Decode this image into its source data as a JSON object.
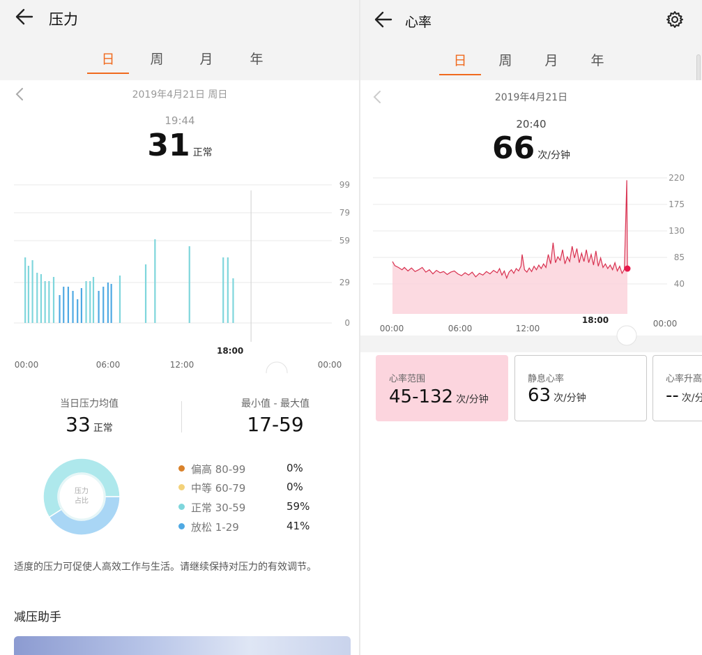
{
  "stress": {
    "title": "压力",
    "tabs": [
      "日",
      "周",
      "月",
      "年"
    ],
    "active_tab": 0,
    "date": "2019年4月21日 周日",
    "time": "19:44",
    "value": "31",
    "value_label": "正常",
    "chart_data": {
      "type": "bar",
      "y_ticks": [
        "99",
        "79",
        "59",
        "29",
        "0"
      ],
      "y_tick_values": [
        99,
        79,
        59,
        29,
        0
      ],
      "x_ticks": [
        "00:00",
        "06:00",
        "12:00",
        "18:00",
        "00:00"
      ],
      "ylim": [
        0,
        99
      ],
      "xlim_hours": [
        0,
        24
      ],
      "bars": [
        {
          "hour": 0.85,
          "value": 47
        },
        {
          "hour": 1.1,
          "value": 41
        },
        {
          "hour": 1.4,
          "value": 45
        },
        {
          "hour": 1.75,
          "value": 36
        },
        {
          "hour": 2.05,
          "value": 35
        },
        {
          "hour": 2.35,
          "value": 30
        },
        {
          "hour": 2.65,
          "value": 30
        },
        {
          "hour": 3.0,
          "value": 33
        },
        {
          "hour": 3.45,
          "value": 20
        },
        {
          "hour": 3.75,
          "value": 26
        },
        {
          "hour": 4.1,
          "value": 26
        },
        {
          "hour": 4.45,
          "value": 23
        },
        {
          "hour": 4.8,
          "value": 17
        },
        {
          "hour": 5.1,
          "value": 25
        },
        {
          "hour": 5.45,
          "value": 30
        },
        {
          "hour": 5.75,
          "value": 30
        },
        {
          "hour": 6.0,
          "value": 33
        },
        {
          "hour": 6.4,
          "value": 23
        },
        {
          "hour": 6.75,
          "value": 26
        },
        {
          "hour": 7.1,
          "value": 29
        },
        {
          "hour": 7.35,
          "value": 28
        },
        {
          "hour": 8.0,
          "value": 34
        },
        {
          "hour": 9.95,
          "value": 42
        },
        {
          "hour": 10.65,
          "value": 60
        },
        {
          "hour": 13.25,
          "value": 55
        },
        {
          "hour": 15.8,
          "value": 47
        },
        {
          "hour": 16.15,
          "value": 47
        },
        {
          "hour": 16.55,
          "value": 32
        }
      ],
      "cursor_label": "18:00"
    },
    "avg_label": "当日压力均值",
    "avg_value": "33",
    "avg_value_label": "正常",
    "range_label": "最小值 - 最大值",
    "range_value": "17-59",
    "donut_label_1": "压力",
    "donut_label_2": "占比",
    "legend": [
      {
        "label": "偏高 80-99",
        "pct": "0%",
        "color": "#d9822b",
        "value": 0
      },
      {
        "label": "中等 60-79",
        "pct": "0%",
        "color": "#f3d27a",
        "value": 0
      },
      {
        "label": "正常 30-59",
        "pct": "59%",
        "color": "#7fd6dc",
        "value": 59
      },
      {
        "label": "放松 1-29",
        "pct": "41%",
        "color": "#4fa9e3",
        "value": 41
      }
    ],
    "advice": "适度的压力可促使人高效工作与生活。请继续保持对压力的有效调节。",
    "section_title": "减压助手"
  },
  "heart": {
    "title": "心率",
    "tabs": [
      "日",
      "周",
      "月",
      "年"
    ],
    "active_tab": 0,
    "date": "2019年4月21日",
    "time": "20:40",
    "value": "66",
    "unit": "次/分钟",
    "chart_data": {
      "type": "area",
      "y_ticks": [
        "220",
        "175",
        "130",
        "85",
        "40"
      ],
      "y_tick_values": [
        220,
        175,
        130,
        85,
        40
      ],
      "x_ticks": [
        "00:00",
        "06:00",
        "12:00",
        "18:00",
        "00:00"
      ],
      "ylim": [
        40,
        220
      ],
      "xlim_hours": [
        0,
        24
      ],
      "cursor_label": "18:00",
      "series": [
        {
          "values": [
            [
              0.0,
              78
            ],
            [
              0.2,
              71
            ],
            [
              0.5,
              68
            ],
            [
              0.8,
              64
            ],
            [
              1.0,
              68
            ],
            [
              1.3,
              62
            ],
            [
              1.6,
              67
            ],
            [
              1.9,
              61
            ],
            [
              2.2,
              64
            ],
            [
              2.5,
              68
            ],
            [
              2.8,
              60
            ],
            [
              3.1,
              64
            ],
            [
              3.4,
              57
            ],
            [
              3.7,
              63
            ],
            [
              4.0,
              59
            ],
            [
              4.3,
              61
            ],
            [
              4.6,
              56
            ],
            [
              4.9,
              60
            ],
            [
              5.2,
              62
            ],
            [
              5.5,
              57
            ],
            [
              5.8,
              54
            ],
            [
              6.1,
              59
            ],
            [
              6.4,
              55
            ],
            [
              6.7,
              60
            ],
            [
              7.0,
              52
            ],
            [
              7.3,
              58
            ],
            [
              7.6,
              55
            ],
            [
              7.9,
              61
            ],
            [
              8.2,
              57
            ],
            [
              8.5,
              63
            ],
            [
              8.8,
              59
            ],
            [
              9.0,
              66
            ],
            [
              9.2,
              55
            ],
            [
              9.4,
              62
            ],
            [
              9.6,
              50
            ],
            [
              9.8,
              60
            ],
            [
              10.0,
              64
            ],
            [
              10.2,
              58
            ],
            [
              10.4,
              66
            ],
            [
              10.6,
              62
            ],
            [
              10.8,
              70
            ],
            [
              10.9,
              90
            ],
            [
              11.1,
              64
            ],
            [
              11.3,
              60
            ],
            [
              11.5,
              67
            ],
            [
              11.7,
              61
            ],
            [
              11.9,
              70
            ],
            [
              12.1,
              64
            ],
            [
              12.3,
              72
            ],
            [
              12.5,
              66
            ],
            [
              12.7,
              74
            ],
            [
              12.9,
              68
            ],
            [
              13.1,
              90
            ],
            [
              13.3,
              74
            ],
            [
              13.5,
              110
            ],
            [
              13.7,
              76
            ],
            [
              13.9,
              86
            ],
            [
              14.1,
              80
            ],
            [
              14.3,
              98
            ],
            [
              14.5,
              74
            ],
            [
              14.7,
              86
            ],
            [
              14.9,
              78
            ],
            [
              15.1,
              104
            ],
            [
              15.3,
              84
            ],
            [
              15.5,
              100
            ],
            [
              15.7,
              76
            ],
            [
              15.9,
              92
            ],
            [
              16.1,
              78
            ],
            [
              16.3,
              98
            ],
            [
              16.5,
              76
            ],
            [
              16.7,
              90
            ],
            [
              16.9,
              72
            ],
            [
              17.1,
              96
            ],
            [
              17.3,
              70
            ],
            [
              17.5,
              84
            ],
            [
              17.7,
              68
            ],
            [
              17.9,
              74
            ],
            [
              18.1,
              66
            ],
            [
              18.3,
              72
            ],
            [
              18.5,
              64
            ],
            [
              18.7,
              76
            ],
            [
              18.9,
              62
            ],
            [
              19.1,
              70
            ],
            [
              19.3,
              58
            ],
            [
              19.5,
              65
            ],
            [
              19.7,
              216
            ],
            [
              19.75,
              66
            ]
          ]
        }
      ]
    },
    "cards": [
      {
        "label": "心率范围",
        "value": "45-132",
        "unit": "次/分钟"
      },
      {
        "label": "静息心率",
        "value": "63",
        "unit": "次/分钟"
      },
      {
        "label": "心率升高",
        "value": "--",
        "unit": "次/分钟"
      }
    ]
  }
}
